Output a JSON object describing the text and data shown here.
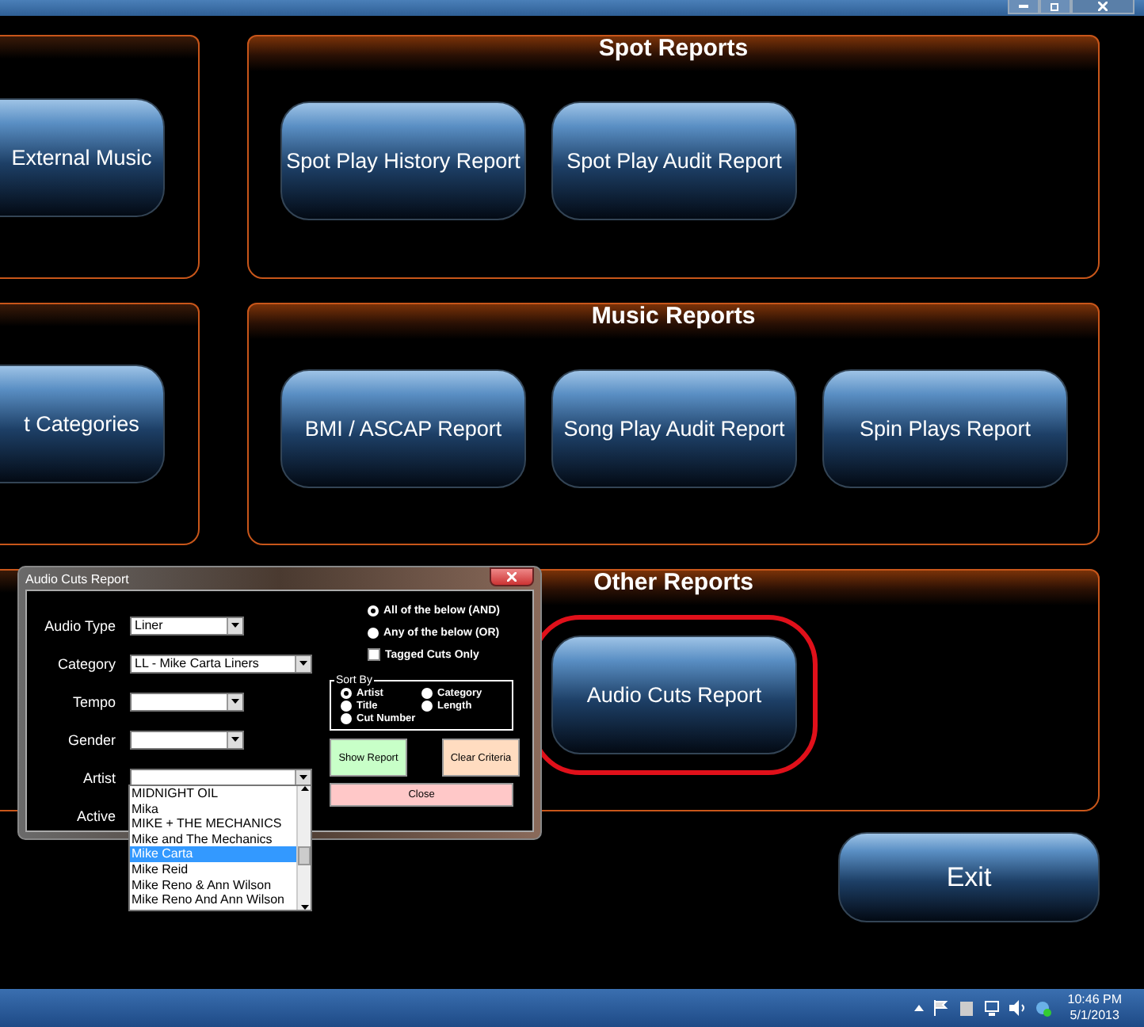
{
  "left_panels": [
    {
      "buttons": [
        "External Music"
      ]
    },
    {
      "buttons": [
        "t Categories"
      ]
    }
  ],
  "report_groups": [
    {
      "title": "Spot Reports",
      "buttons": [
        {
          "label": "Spot Play History Report",
          "highlighted": false
        },
        {
          "label": "Spot Play Audit Report",
          "highlighted": false
        }
      ]
    },
    {
      "title": "Music Reports",
      "buttons": [
        {
          "label": "BMI / ASCAP Report",
          "highlighted": false
        },
        {
          "label": "Song Play Audit Report",
          "highlighted": false
        },
        {
          "label": "Spin Plays Report",
          "highlighted": false
        }
      ]
    },
    {
      "title": "Other Reports",
      "buttons": [
        {
          "label": "Audio Cuts Report",
          "highlighted": true
        }
      ]
    }
  ],
  "exit_button": "Exit",
  "dialog": {
    "title": "Audio Cuts Report",
    "fields": [
      {
        "label": "Audio Type",
        "value": "Liner",
        "wide": false
      },
      {
        "label": "Category",
        "value": "LL - Mike Carta Liners",
        "wide": true
      },
      {
        "label": "Tempo",
        "wide": false
      },
      {
        "label": "Gender",
        "wide": false
      },
      {
        "label": "Artist",
        "wide": true
      },
      {
        "label": "Active"
      }
    ],
    "match_modes": [
      {
        "label": "All of the below (AND)",
        "selected": true
      },
      {
        "label": "Any of the below (OR)",
        "selected": false
      }
    ],
    "tagged_only": {
      "label": "Tagged Cuts Only",
      "checked": false
    },
    "sort_by": {
      "title": "Sort By",
      "options": [
        {
          "label": "Artist",
          "selected": true
        },
        {
          "label": "Category",
          "selected": false
        },
        {
          "label": "Title",
          "selected": false
        },
        {
          "label": "Length",
          "selected": false
        },
        {
          "label": "Cut Number",
          "selected": false
        }
      ]
    },
    "buttons": [
      {
        "label": "Show Report",
        "kind": "show"
      },
      {
        "label": "Clear Criteria",
        "kind": "clear"
      },
      {
        "label": "Close",
        "kind": "close"
      }
    ],
    "artist_list": [
      {
        "label": "MIDNIGHT OIL",
        "selected": false
      },
      {
        "label": "Mika",
        "selected": false
      },
      {
        "label": "MIKE + THE MECHANICS",
        "selected": false
      },
      {
        "label": "Mike and The Mechanics",
        "selected": false
      },
      {
        "label": "Mike Carta",
        "selected": true
      },
      {
        "label": "Mike Reid",
        "selected": false
      },
      {
        "label": "Mike Reno & Ann Wilson",
        "selected": false
      },
      {
        "label": "Mike Reno And Ann Wilson",
        "selected": false
      }
    ]
  },
  "taskbar": {
    "time": "10:46 PM",
    "date": "5/1/2013"
  }
}
